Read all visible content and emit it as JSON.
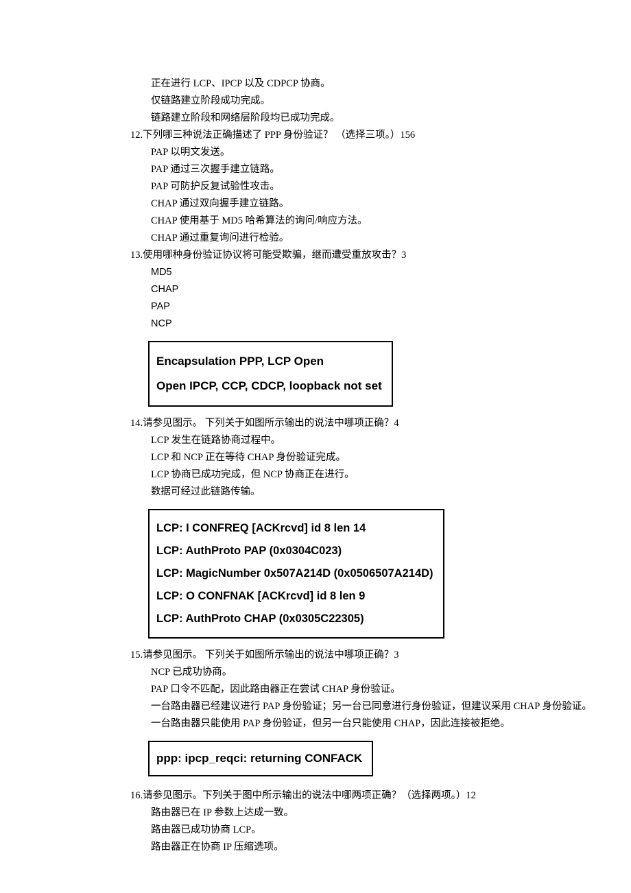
{
  "pre11": {
    "a": "正在进行 LCP、IPCP 以及 CDPCP 协商。",
    "b": "仅链路建立阶段成功完成。",
    "c": "链路建立阶段和网络层阶段均已成功完成。"
  },
  "q12": {
    "title": "12.下列哪三种说法正确描述了 PPP 身份验证？ （选择三项。）156",
    "a": "PAP 以明文发送。",
    "b": "PAP 通过三次握手建立链路。",
    "c": "PAP 可防护反复试验性攻击。",
    "d": "CHAP 通过双向握手建立链路。",
    "e": "CHAP 使用基于 MD5 哈希算法的询问/响应方法。",
    "f": "CHAP 通过重复询问进行检验。"
  },
  "q13": {
    "title": "13.使用哪种身份验证协议将可能受欺骗，继而遭受重放攻击？3",
    "a": "MD5",
    "b": "CHAP",
    "c": "PAP",
    "d": "NCP"
  },
  "box1": {
    "l1": "Encapsulation PPP, LCP Open",
    "l2": "Open IPCP, CCP, CDCP, loopback not set"
  },
  "q14": {
    "title": "14.请参见图示。 下列关于如图所示输出的说法中哪项正确？4",
    "a": "LCP 发生在链路协商过程中。",
    "b": "LCP 和 NCP 正在等待 CHAP 身份验证完成。",
    "c": "LCP 协商已成功完成，但 NCP 协商正在进行。",
    "d": "数据可经过此链路传输。"
  },
  "box2": {
    "l1": "LCP: I CONFREQ [ACKrcvd] id 8 len 14",
    "l2": "LCP: AuthProto PAP (0x0304C023)",
    "l3": "LCP: MagicNumber 0x507A214D (0x0506507A214D)",
    "l4": "LCP: O CONFNAK [ACKrcvd] id 8 len 9",
    "l5": "LCP: AuthProto CHAP (0x0305C22305)"
  },
  "q15": {
    "title": "15.请参见图示。 下列关于如图所示输出的说法中哪项正确？3",
    "a": "NCP 已成功协商。",
    "b": "PAP 口令不匹配，因此路由器正在尝试 CHAP 身份验证。",
    "c": "一台路由器已经建议进行 PAP 身份验证；另一台已同意进行身份验证，但建议采用 CHAP 身份验证。",
    "d": "一台路由器只能使用 PAP 身份验证，但另一台只能使用 CHAP，因此连接被拒绝。"
  },
  "box3": {
    "l1": "ppp: ipcp_reqci: returning CONFACK"
  },
  "q16": {
    "title": "16.请参见图示。下列关于图中所示输出的说法中哪两项正确？（选择两项。）12",
    "a": "路由器已在 IP 参数上达成一致。",
    "b": "路由器已成功协商 LCP。",
    "c": "路由器正在协商 IP 压缩选项。"
  }
}
